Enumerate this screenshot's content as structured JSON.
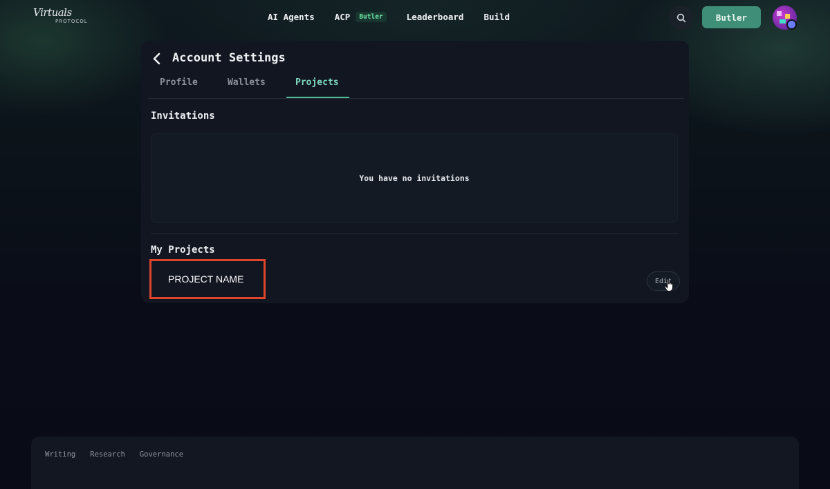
{
  "brand": {
    "logo_script": "Virtuals",
    "logo_sub": "PROTOCOL"
  },
  "nav": {
    "items": [
      {
        "label": "AI Agents"
      },
      {
        "label": "ACP",
        "badge": "Butler"
      },
      {
        "label": "Leaderboard"
      },
      {
        "label": "Build"
      }
    ],
    "search_icon": "search-icon",
    "cta_label": "Butler",
    "accent_color": "#3f8e78"
  },
  "settings": {
    "title": "Account Settings",
    "tabs": [
      {
        "label": "Profile",
        "active": false
      },
      {
        "label": "Wallets",
        "active": false
      },
      {
        "label": "Projects",
        "active": true
      }
    ],
    "invitations": {
      "heading": "Invitations",
      "empty_text": "You have no invitations"
    },
    "projects": {
      "heading": "My Projects",
      "items": [
        {
          "name": "PROJECT NAME",
          "edit_label": "Edit"
        }
      ]
    }
  },
  "footer": {
    "links": [
      "Writing",
      "Research",
      "Governance"
    ]
  }
}
